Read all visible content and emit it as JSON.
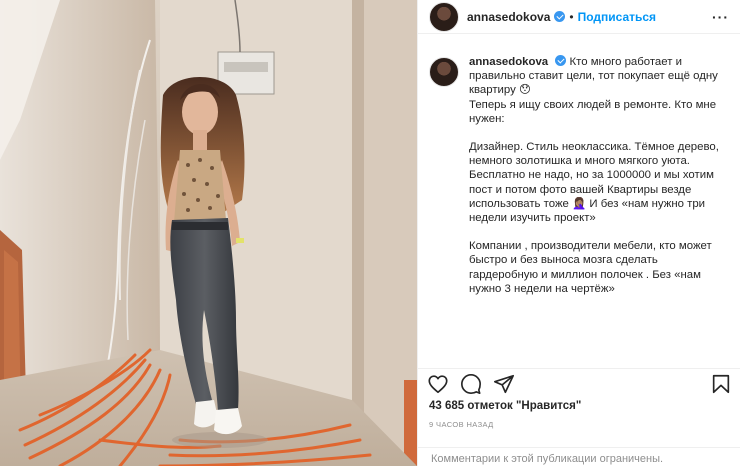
{
  "header": {
    "username": "annasedokova",
    "separator": "•",
    "follow_label": "Подписаться",
    "more_label": "···"
  },
  "caption": {
    "username": "annasedokova",
    "paragraph_1": "Кто много работает и правильно ставит цели, тот покупает ещё одну квартиру 😯\nТеперь я ищу своих людей в ремонте. Кто мне нужен:",
    "paragraph_2": "Дизайнер. Стиль неоклассика. Тёмное дерево, немного золотишка и много мягкого уюта. Бесплатно не надо, но за 1000000 и мы хотим пост и потом фото вашей Квартиры везде использовать тоже 🤦🏽‍♀️ И без «нам нужно три недели изучить проект»",
    "paragraph_3": "Компании , производители мебели, кто может быстро и без выноса мозга сделать гардеробную и миллион полочек . Без «нам нужно 3 недели на чертёж»"
  },
  "actions": {
    "like_icon": "heart-icon",
    "comment_icon": "comment-icon",
    "share_icon": "share-icon",
    "save_icon": "bookmark-icon"
  },
  "likes_text": "43 685 отметок \"Нравится\"",
  "timestamp": "9 ЧАСОВ НАЗАД",
  "comments_notice": "Комментарии к этой публикации ограничены.",
  "colors": {
    "link_blue": "#0095f6",
    "verified_blue": "#3897f0",
    "muted": "#8e8e8e"
  }
}
